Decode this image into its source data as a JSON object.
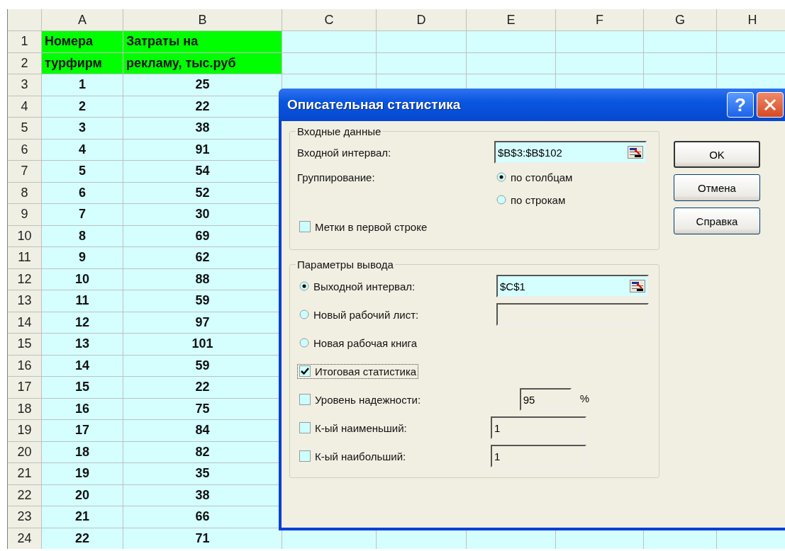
{
  "sheet": {
    "columns": [
      "A",
      "B",
      "C",
      "D",
      "E",
      "F",
      "G",
      "H"
    ],
    "rows": [
      {
        "number": "1",
        "kind": "header",
        "cells": [
          "Номера",
          "Затраты на"
        ]
      },
      {
        "number": "2",
        "kind": "header",
        "cells": [
          "турфирм",
          "рекламу, тыс.руб"
        ]
      },
      {
        "number": "3",
        "kind": "data",
        "cells": [
          "1",
          "25"
        ]
      },
      {
        "number": "4",
        "kind": "data",
        "cells": [
          "2",
          "22"
        ]
      },
      {
        "number": "5",
        "kind": "data",
        "cells": [
          "3",
          "38"
        ]
      },
      {
        "number": "6",
        "kind": "data",
        "cells": [
          "4",
          "91"
        ]
      },
      {
        "number": "7",
        "kind": "data",
        "cells": [
          "5",
          "54"
        ]
      },
      {
        "number": "8",
        "kind": "data",
        "cells": [
          "6",
          "52"
        ]
      },
      {
        "number": "9",
        "kind": "data",
        "cells": [
          "7",
          "30"
        ]
      },
      {
        "number": "10",
        "kind": "data",
        "cells": [
          "8",
          "69"
        ]
      },
      {
        "number": "11",
        "kind": "data",
        "cells": [
          "9",
          "62"
        ]
      },
      {
        "number": "12",
        "kind": "data",
        "cells": [
          "10",
          "88"
        ]
      },
      {
        "number": "13",
        "kind": "data",
        "cells": [
          "11",
          "59"
        ]
      },
      {
        "number": "14",
        "kind": "data",
        "cells": [
          "12",
          "97"
        ]
      },
      {
        "number": "15",
        "kind": "data",
        "cells": [
          "13",
          "101"
        ]
      },
      {
        "number": "16",
        "kind": "data",
        "cells": [
          "14",
          "59"
        ]
      },
      {
        "number": "17",
        "kind": "data",
        "cells": [
          "15",
          "22"
        ]
      },
      {
        "number": "18",
        "kind": "data",
        "cells": [
          "16",
          "75"
        ]
      },
      {
        "number": "19",
        "kind": "data",
        "cells": [
          "17",
          "84"
        ]
      },
      {
        "number": "20",
        "kind": "data",
        "cells": [
          "18",
          "82"
        ]
      },
      {
        "number": "21",
        "kind": "data",
        "cells": [
          "19",
          "35"
        ]
      },
      {
        "number": "22",
        "kind": "data",
        "cells": [
          "20",
          "38"
        ]
      },
      {
        "number": "23",
        "kind": "data",
        "cells": [
          "21",
          "66"
        ]
      },
      {
        "number": "24",
        "kind": "data",
        "cells": [
          "22",
          "71"
        ]
      }
    ]
  },
  "dialog": {
    "title": "Описательная статистика",
    "help_button": "?",
    "input_group": {
      "title": "Входные данные",
      "input_range": {
        "label": "Входной интервал:",
        "value": "$B$3:$B$102"
      },
      "grouping": {
        "label": "Группирование:",
        "options": [
          {
            "label": "по столбцам",
            "selected": true
          },
          {
            "label": "по строкам",
            "selected": false
          }
        ]
      },
      "labels_in_first_row": {
        "label": "Метки в первой строке",
        "checked": false
      }
    },
    "output_group": {
      "title": "Параметры вывода",
      "items": [
        {
          "kind": "radio",
          "label": "Выходной интервал:",
          "selected": true,
          "focused": false,
          "field": {
            "kind": "range",
            "value": "$C$1",
            "disabled": false
          }
        },
        {
          "kind": "radio",
          "label": "Новый рабочий лист:",
          "selected": false,
          "focused": false,
          "field": {
            "kind": "text",
            "disabled": true
          }
        },
        {
          "kind": "radio",
          "label": "Новая рабочая книга",
          "selected": false,
          "focused": false
        },
        {
          "kind": "checkbox",
          "label": "Итоговая статистика",
          "checked": true,
          "focused": true
        },
        {
          "kind": "checkbox",
          "label": "Уровень надежности:",
          "checked": false,
          "focused": false,
          "field": {
            "kind": "percent",
            "value": "95",
            "suffix": "%",
            "disabled": true
          }
        },
        {
          "kind": "checkbox",
          "label": "К-ый наименьший:",
          "checked": false,
          "focused": false,
          "field": {
            "kind": "number",
            "value": "1",
            "disabled": true
          }
        },
        {
          "kind": "checkbox",
          "label": "К-ый наибольший:",
          "checked": false,
          "focused": false,
          "field": {
            "kind": "number",
            "value": "1",
            "disabled": true
          }
        }
      ]
    },
    "buttons": [
      {
        "label": "OK",
        "default": true
      },
      {
        "label": "Отмена",
        "default": false
      },
      {
        "label": "Справка",
        "default": false
      }
    ]
  }
}
